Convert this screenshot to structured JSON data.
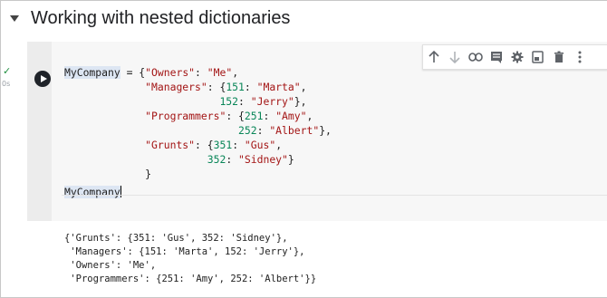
{
  "section": {
    "title": "Working with nested dictionaries"
  },
  "toolbar": {
    "icons": [
      "arrow-up-icon",
      "arrow-down-icon",
      "link-icon",
      "comment-icon",
      "gear-icon",
      "mirror-cell-icon",
      "delete-icon",
      "more-icon"
    ]
  },
  "cell": {
    "status": {
      "check": "✓",
      "runtime": "0s"
    },
    "code_lines": [
      {
        "tokens": [
          {
            "t": "MyCompany",
            "c": "var"
          },
          {
            "t": " = {",
            "c": ""
          },
          {
            "t": "\"Owners\"",
            "c": "str"
          },
          {
            "t": ": ",
            "c": ""
          },
          {
            "t": "\"Me\"",
            "c": "str"
          },
          {
            "t": ",",
            "c": ""
          }
        ]
      },
      {
        "tokens": [
          {
            "t": "             ",
            "c": ""
          },
          {
            "t": "\"Managers\"",
            "c": "str"
          },
          {
            "t": ": {",
            "c": ""
          },
          {
            "t": "151",
            "c": "num"
          },
          {
            "t": ": ",
            "c": ""
          },
          {
            "t": "\"Marta\"",
            "c": "str"
          },
          {
            "t": ",",
            "c": ""
          }
        ]
      },
      {
        "tokens": [
          {
            "t": "                         ",
            "c": ""
          },
          {
            "t": "152",
            "c": "num"
          },
          {
            "t": ": ",
            "c": ""
          },
          {
            "t": "\"Jerry\"",
            "c": "str"
          },
          {
            "t": "},",
            "c": ""
          }
        ]
      },
      {
        "tokens": [
          {
            "t": "             ",
            "c": ""
          },
          {
            "t": "\"Programmers\"",
            "c": "str"
          },
          {
            "t": ": {",
            "c": ""
          },
          {
            "t": "251",
            "c": "num"
          },
          {
            "t": ": ",
            "c": ""
          },
          {
            "t": "\"Amy\"",
            "c": "str"
          },
          {
            "t": ",",
            "c": ""
          }
        ]
      },
      {
        "tokens": [
          {
            "t": "                            ",
            "c": ""
          },
          {
            "t": "252",
            "c": "num"
          },
          {
            "t": ": ",
            "c": ""
          },
          {
            "t": "\"Albert\"",
            "c": "str"
          },
          {
            "t": "},",
            "c": ""
          }
        ]
      },
      {
        "tokens": [
          {
            "t": "             ",
            "c": ""
          },
          {
            "t": "\"Grunts\"",
            "c": "str"
          },
          {
            "t": ": {",
            "c": ""
          },
          {
            "t": "351",
            "c": "num"
          },
          {
            "t": ": ",
            "c": ""
          },
          {
            "t": "\"Gus\"",
            "c": "str"
          },
          {
            "t": ",",
            "c": ""
          }
        ]
      },
      {
        "tokens": [
          {
            "t": "                       ",
            "c": ""
          },
          {
            "t": "352",
            "c": "num"
          },
          {
            "t": ": ",
            "c": ""
          },
          {
            "t": "\"Sidney\"",
            "c": "str"
          },
          {
            "t": "}",
            "c": ""
          }
        ]
      },
      {
        "tokens": [
          {
            "t": "             }",
            "c": ""
          }
        ]
      }
    ],
    "last_line": "MyCompany"
  },
  "output": {
    "lines": [
      "{'Grunts': {351: 'Gus', 352: 'Sidney'},",
      " 'Managers': {151: 'Marta', 152: 'Jerry'},",
      " 'Owners': 'Me',",
      " 'Programmers': {251: 'Amy', 252: 'Albert'}}"
    ]
  }
}
